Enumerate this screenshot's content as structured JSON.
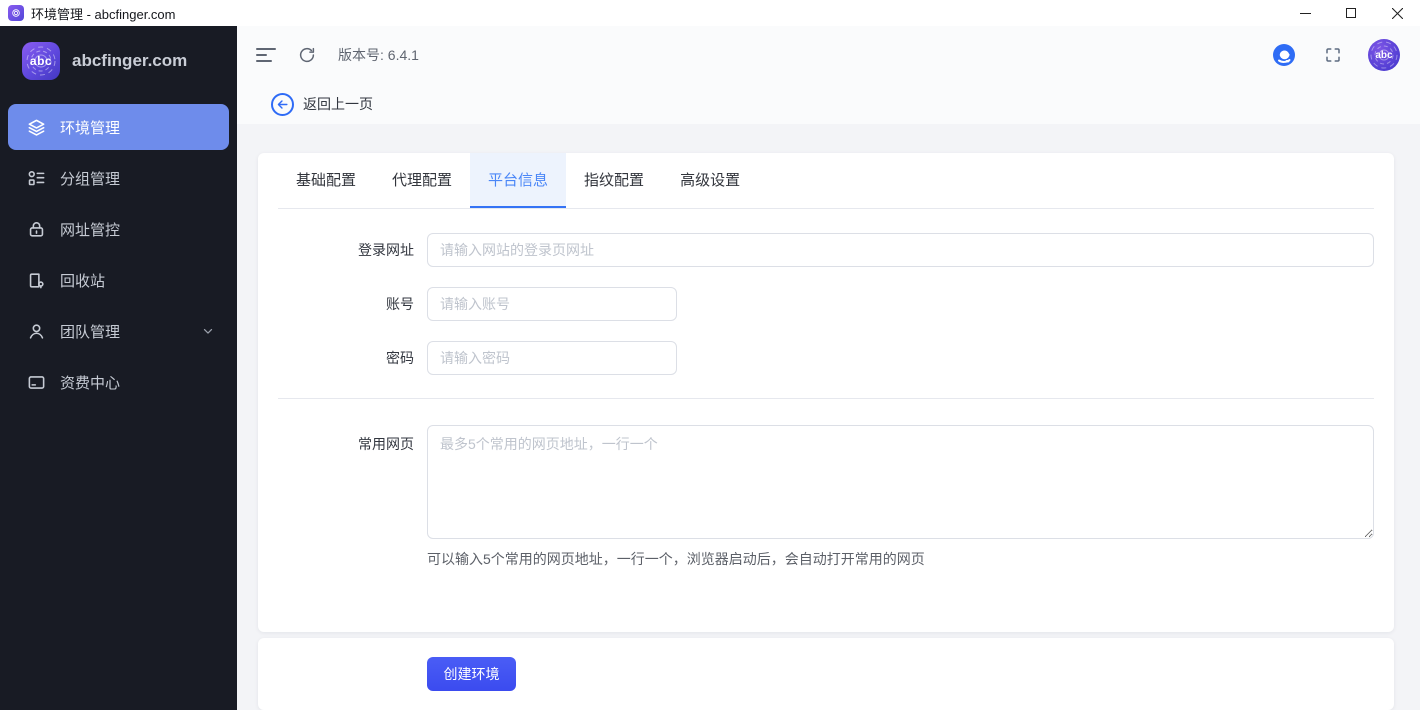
{
  "window": {
    "title": "环境管理 - abcfinger.com"
  },
  "sidebar": {
    "brand": "abcfinger.com",
    "brand_logo_text": "abc",
    "items": [
      {
        "label": "环境管理",
        "icon": "layers-icon",
        "active": true
      },
      {
        "label": "分组管理",
        "icon": "group-icon",
        "active": false
      },
      {
        "label": "网址管控",
        "icon": "lock-icon",
        "active": false
      },
      {
        "label": "回收站",
        "icon": "recycle-bin-icon",
        "active": false
      },
      {
        "label": "团队管理",
        "icon": "team-icon",
        "active": false,
        "expandable": true
      },
      {
        "label": "资费中心",
        "icon": "billing-card-icon",
        "active": false
      }
    ]
  },
  "toolbar": {
    "version": "版本号: 6.4.1",
    "avatar_text": "abc"
  },
  "navigation": {
    "back_label": "返回上一页"
  },
  "tabs": [
    {
      "label": "基础配置",
      "active": false
    },
    {
      "label": "代理配置",
      "active": false
    },
    {
      "label": "平台信息",
      "active": true
    },
    {
      "label": "指纹配置",
      "active": false
    },
    {
      "label": "高级设置",
      "active": false
    }
  ],
  "form": {
    "login_url": {
      "label": "登录网址",
      "value": "",
      "placeholder": "请输入网站的登录页网址"
    },
    "account": {
      "label": "账号",
      "value": "",
      "placeholder": "请输入账号"
    },
    "password": {
      "label": "密码",
      "value": "",
      "placeholder": "请输入密码"
    },
    "common_pages": {
      "label": "常用网页",
      "value": "",
      "placeholder": "最多5个常用的网页地址，一行一个",
      "hint": "可以输入5个常用的网页地址，一行一个，浏览器启动后，会自动打开常用的网页"
    }
  },
  "footer": {
    "create_button": "创建环境"
  },
  "colors": {
    "accent": "#2e6bf6",
    "active_tab": "#4a86f7",
    "active_sidebar_item": "#6e8ceb",
    "sidebar_bg": "#181b24",
    "create_button": "#3f50f1"
  }
}
